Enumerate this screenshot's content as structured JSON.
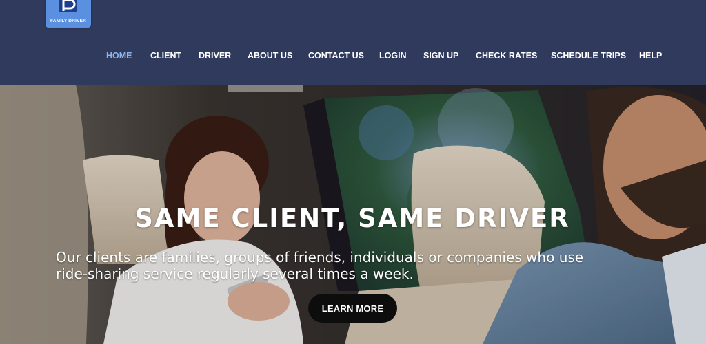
{
  "brand": {
    "name": "FAMILY DRIVER"
  },
  "nav": {
    "items": [
      {
        "label": "HOME",
        "active": true
      },
      {
        "label": "CLIENT"
      },
      {
        "label": "DRIVER"
      },
      {
        "label": "ABOUT US"
      },
      {
        "label": "CONTACT US"
      },
      {
        "label": "LOGIN"
      },
      {
        "label": "SIGN UP"
      },
      {
        "label": "CHECK RATES"
      },
      {
        "label": "SCHEDULE TRIPS"
      },
      {
        "label": "HELP"
      }
    ]
  },
  "hero": {
    "headline": "SAME CLIENT, SAME DRIVER",
    "subtext_line1": "Our clients are families, groups of friends, individuals or companies who use",
    "subtext_line2": "ride-sharing service regularly several times a week.",
    "button_label": "LEARN MORE"
  },
  "colors": {
    "header_bg": "#2f3a5c",
    "nav_text": "#ffffff",
    "nav_active": "#8fb3ea",
    "logo_bg": "#5b8fe0",
    "button_bg": "#0d0d0d"
  }
}
